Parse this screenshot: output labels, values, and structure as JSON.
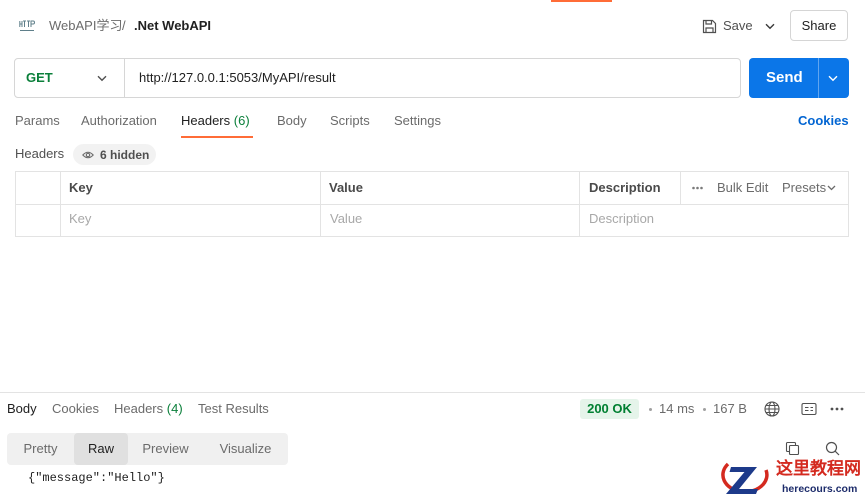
{
  "header": {
    "collection": "WebAPI学习",
    "separator": "/",
    "request_name": ".Net WebAPI",
    "save_label": "Save",
    "share_label": "Share",
    "request_icon": "http-request-icon"
  },
  "request": {
    "method": "GET",
    "url": "http://127.0.0.1:5053/MyAPI/result",
    "send_label": "Send"
  },
  "request_tabs": [
    {
      "label": "Params"
    },
    {
      "label": "Authorization"
    },
    {
      "label": "Headers",
      "count": "(6)",
      "active": true
    },
    {
      "label": "Body"
    },
    {
      "label": "Scripts"
    },
    {
      "label": "Settings"
    }
  ],
  "cookies_label": "Cookies",
  "headers_panel": {
    "title": "Headers",
    "hidden_label": "6 hidden",
    "columns": [
      "Key",
      "Value",
      "Description"
    ],
    "bulk_edit_label": "Bulk Edit",
    "presets_label": "Presets",
    "new_row_placeholders": {
      "key": "Key",
      "value": "Value",
      "description": "Description"
    }
  },
  "response": {
    "tabs": [
      {
        "label": "Body",
        "active": true
      },
      {
        "label": "Cookies"
      },
      {
        "label": "Headers",
        "count": "(4)"
      },
      {
        "label": "Test Results"
      }
    ],
    "status": "200 OK",
    "time": "14 ms",
    "size": "167 B",
    "views": [
      {
        "label": "Pretty"
      },
      {
        "label": "Raw",
        "selected": true
      },
      {
        "label": "Preview"
      },
      {
        "label": "Visualize"
      }
    ],
    "body": "{\"message\":\"Hello\"}"
  },
  "watermark": {
    "name": "这里教程网",
    "site": "herecours.com"
  },
  "colors": {
    "accent": "#ff6c37",
    "send_button": "#0b76e8",
    "method_get": "#0a7f3a",
    "status_ok": "#007f31",
    "link": "#0265d2"
  }
}
